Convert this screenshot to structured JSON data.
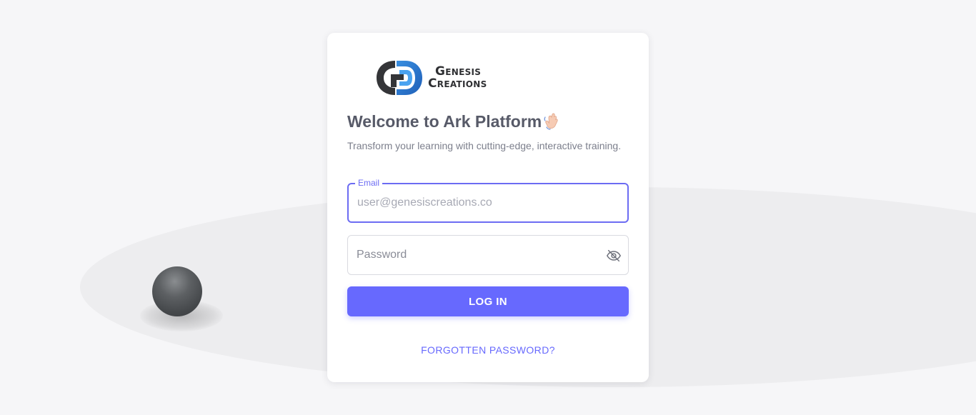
{
  "brand": {
    "name_line1": "Genesis",
    "name_line2": "Creations"
  },
  "login": {
    "title": "Welcome to Ark Platform",
    "title_emoji_icon": "waving-hand-icon",
    "subtitle": "Transform your learning with cutting-edge, interactive training.",
    "email_label": "Email",
    "email_placeholder": "user@genesiscreations.co",
    "email_value": "",
    "password_placeholder": "Password",
    "password_value": "",
    "password_toggle_icon": "eye-off-icon",
    "login_button": "LOG IN",
    "forgot_link": "FORGOTTEN PASSWORD?"
  },
  "colors": {
    "accent": "#6769fe",
    "focus_border": "#6c6cf3",
    "title_text": "#575a68",
    "background": "#f6f6f8"
  }
}
